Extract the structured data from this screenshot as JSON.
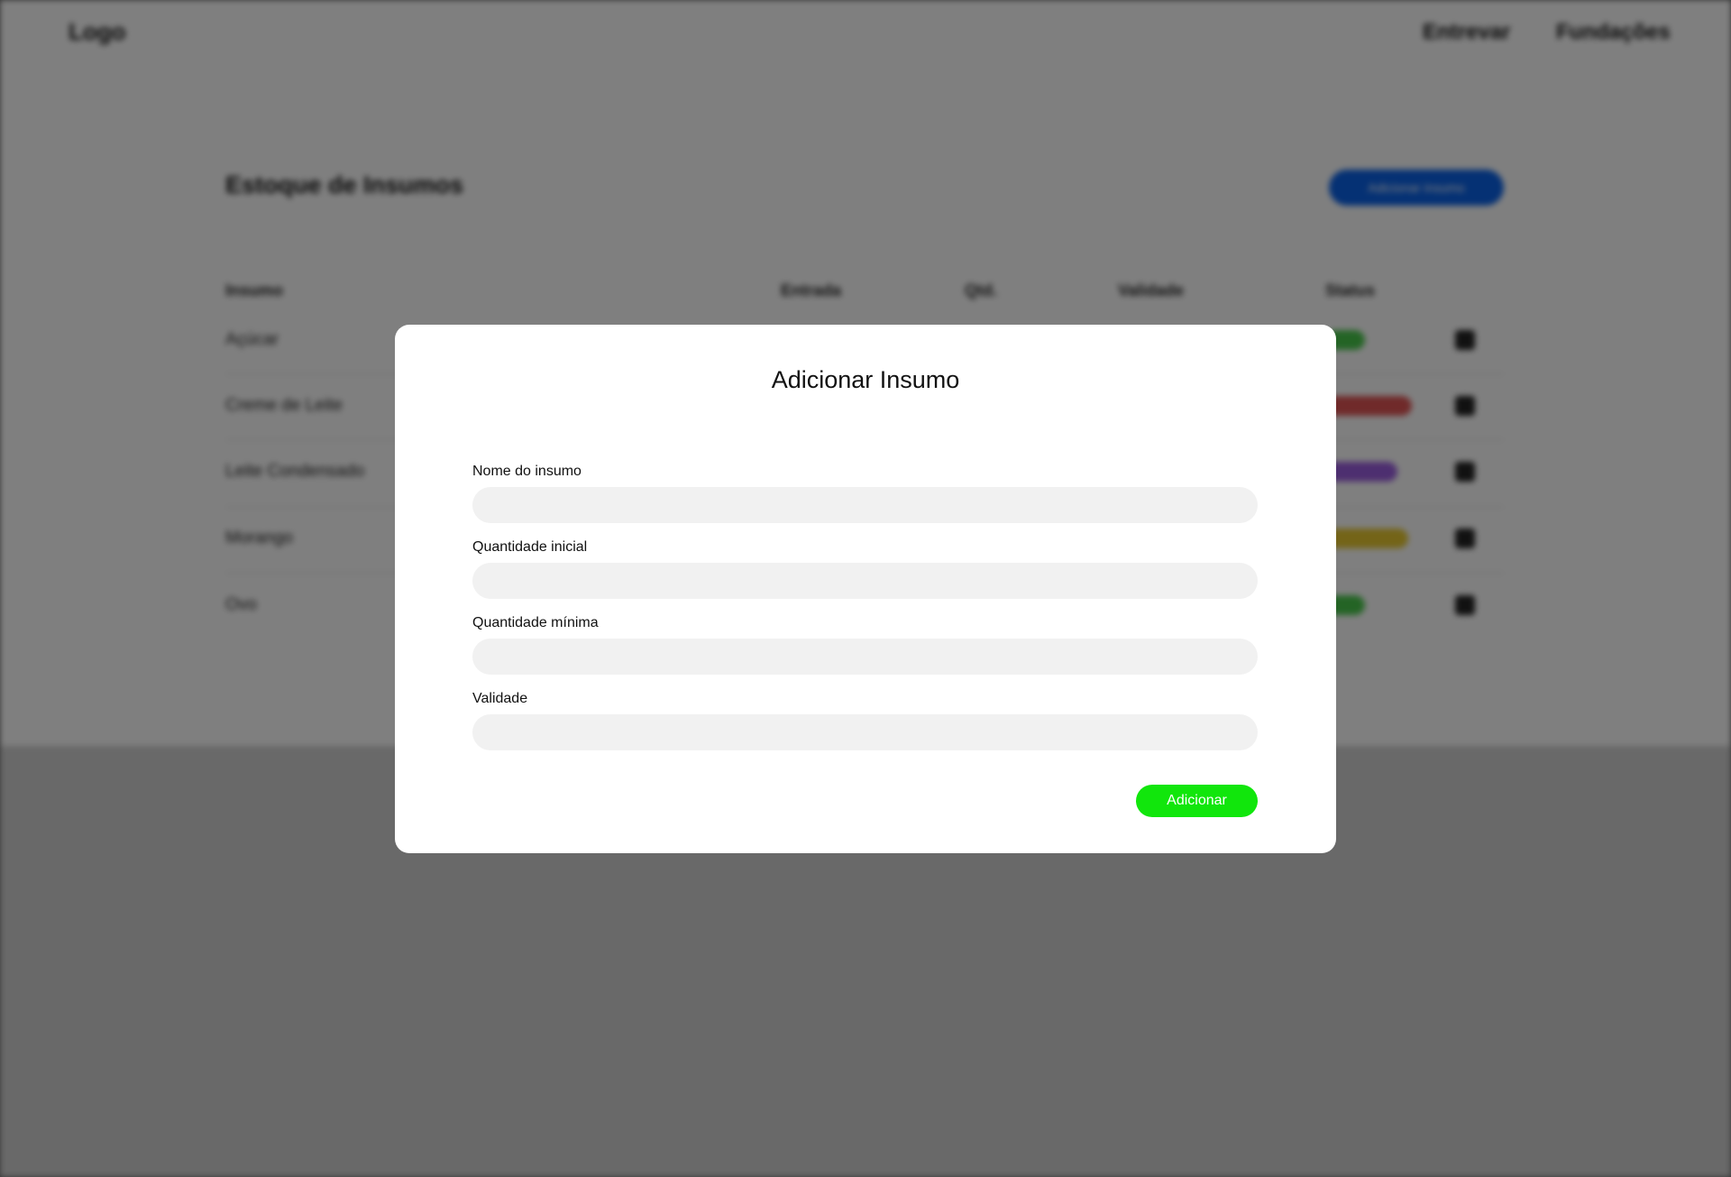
{
  "background": {
    "header": {
      "logo": "Logo",
      "nav_items": [
        "Entrevar",
        "Fundações"
      ]
    },
    "page_title": "Estoque de Insumos",
    "add_button_label": "Adicionar insumo",
    "table": {
      "columns": [
        "Insumo",
        "Entrada",
        "Qtd.",
        "Validade",
        "Status"
      ],
      "rows": [
        {
          "name": "Açúcar",
          "tag_color": "#49c94b"
        },
        {
          "name": "Creme de Leite",
          "tag_color": "#e05555"
        },
        {
          "name": "Leite Condensado",
          "tag_color": "#9b5ee0"
        },
        {
          "name": "Morango",
          "tag_color": "#e8c930"
        },
        {
          "name": "Ovo",
          "tag_color": "#49c94b"
        }
      ]
    }
  },
  "modal": {
    "title": "Adicionar Insumo",
    "fields": [
      {
        "label": "Nome do insumo",
        "value": "",
        "placeholder": ""
      },
      {
        "label": "Quantidade inicial",
        "value": "",
        "placeholder": ""
      },
      {
        "label": "Quantidade mínima",
        "value": "",
        "placeholder": ""
      },
      {
        "label": "Validade",
        "value": "",
        "placeholder": ""
      }
    ],
    "submit_label": "Adicionar",
    "submit_color": "#11e60c"
  }
}
